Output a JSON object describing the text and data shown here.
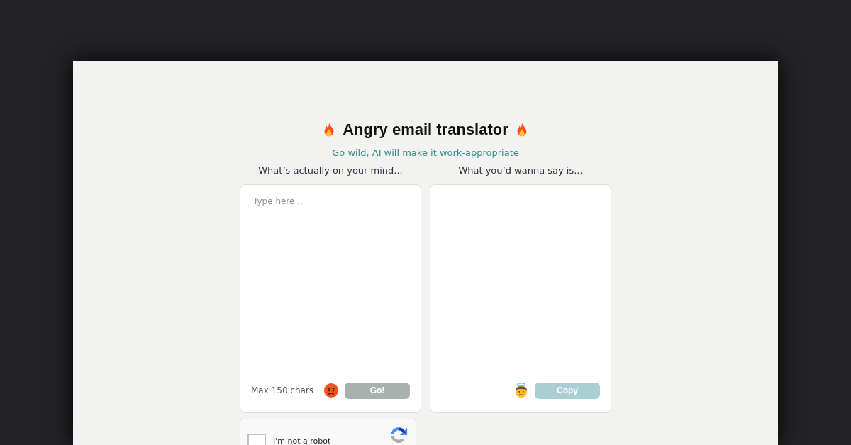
{
  "title": "Angry email translator",
  "subtitle": "Go wild, AI will make it work-appropriate",
  "input_panel": {
    "label": "What’s actually on your mind...",
    "placeholder": "Type here...",
    "hint": "Max 150 chars",
    "button": {
      "label": "Go!",
      "disabled": true
    }
  },
  "output_panel": {
    "label": "What you’d wanna say is...",
    "button": {
      "label": "Copy",
      "disabled": true
    }
  },
  "captcha": {
    "label": "I'm not a robot",
    "checked": false
  }
}
